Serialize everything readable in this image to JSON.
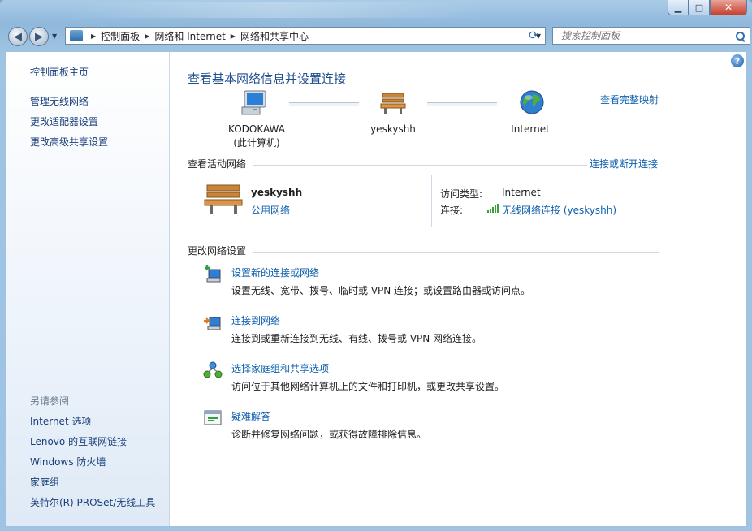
{
  "window": {
    "buttons": {
      "minimize": "▁",
      "maximize": "□",
      "close": "✕"
    }
  },
  "nav": {
    "back_icon": "back-arrow-icon",
    "forward_icon": "forward-arrow-icon",
    "address": {
      "crumbs": [
        "控制面板",
        "网络和 Internet",
        "网络和共享中心"
      ]
    },
    "search": {
      "placeholder": "搜索控制面板"
    }
  },
  "sidebar": {
    "items": [
      "控制面板主页",
      "管理无线网络",
      "更改适配器设置",
      "更改高级共享设置"
    ],
    "see_also_header": "另请参阅",
    "see_also": [
      "Internet 选项",
      "Lenovo 的互联网链接",
      "Windows 防火墙",
      "家庭组",
      "英特尔(R) PROSet/无线工具"
    ]
  },
  "main": {
    "title": "查看基本网络信息并设置连接",
    "full_map_link": "查看完整映射",
    "map": {
      "computer": {
        "name": "KODOKAWA",
        "sub": "(此计算机)"
      },
      "network": {
        "name": "yeskyshh"
      },
      "internet": {
        "name": "Internet"
      }
    },
    "active_networks": {
      "header": "查看活动网络",
      "connect_link": "连接或断开连接",
      "network_name": "yeskyshh",
      "network_type": "公用网络",
      "access_type_label": "访问类型:",
      "access_type_value": "Internet",
      "connection_label": "连接:",
      "connection_value": "无线网络连接 (yeskyshh)"
    },
    "change_settings": {
      "header": "更改网络设置",
      "tasks": [
        {
          "title": "设置新的连接或网络",
          "desc": "设置无线、宽带、拨号、临时或 VPN 连接；或设置路由器或访问点。"
        },
        {
          "title": "连接到网络",
          "desc": "连接到或重新连接到无线、有线、拨号或 VPN 网络连接。"
        },
        {
          "title": "选择家庭组和共享选项",
          "desc": "访问位于其他网络计算机上的文件和打印机，或更改共享设置。"
        },
        {
          "title": "疑难解答",
          "desc": "诊断并修复网络问题，或获得故障排除信息。"
        }
      ]
    },
    "help": "?"
  }
}
